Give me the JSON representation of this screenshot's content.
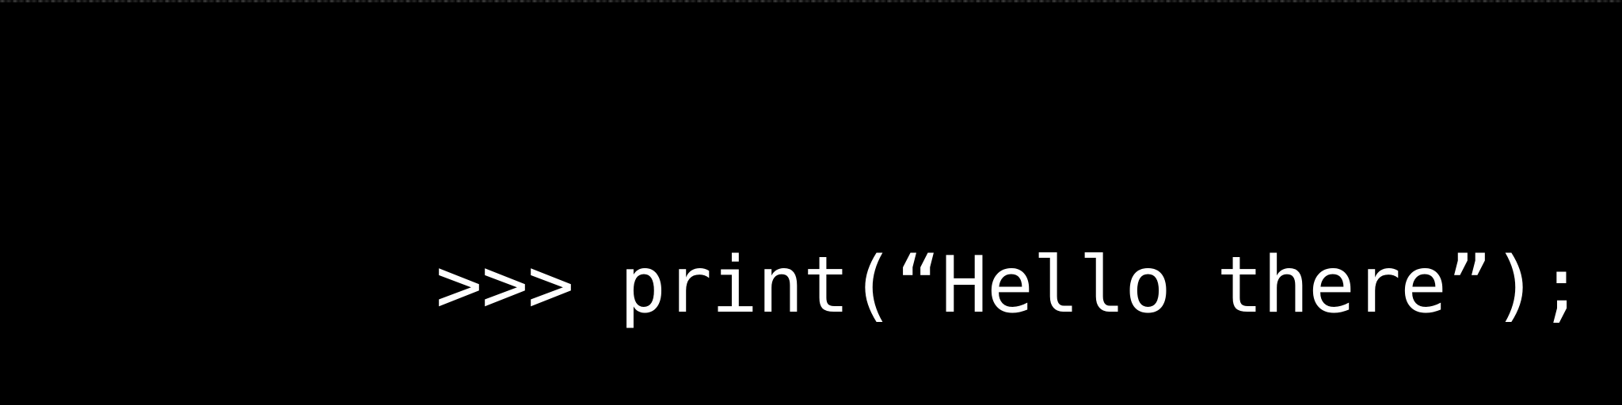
{
  "terminal": {
    "prompt": ">>>",
    "command": "print(“Hello there”);",
    "background": "#000000",
    "text_color": "#ffffff"
  }
}
